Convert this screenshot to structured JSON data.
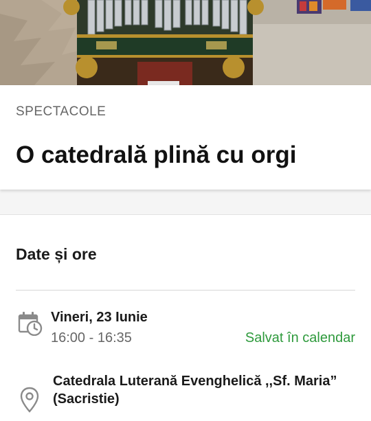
{
  "event": {
    "category": "SPECTACOLE",
    "title": "O catedrală plină cu orgi"
  },
  "details": {
    "section_title": "Date și ore",
    "date": "Vineri, 23 Iunie",
    "time": "16:00 - 16:35",
    "calendar_status": "Salvat în calendar",
    "venue": "Catedrala Luterană Evenghelică ,,Sf. Maria” (Sacristie)"
  },
  "icons": {
    "date": "calendar-clock-icon",
    "venue": "location-pin-icon"
  },
  "colors": {
    "accent_green": "#2e9a3c",
    "muted_text": "#666666"
  }
}
